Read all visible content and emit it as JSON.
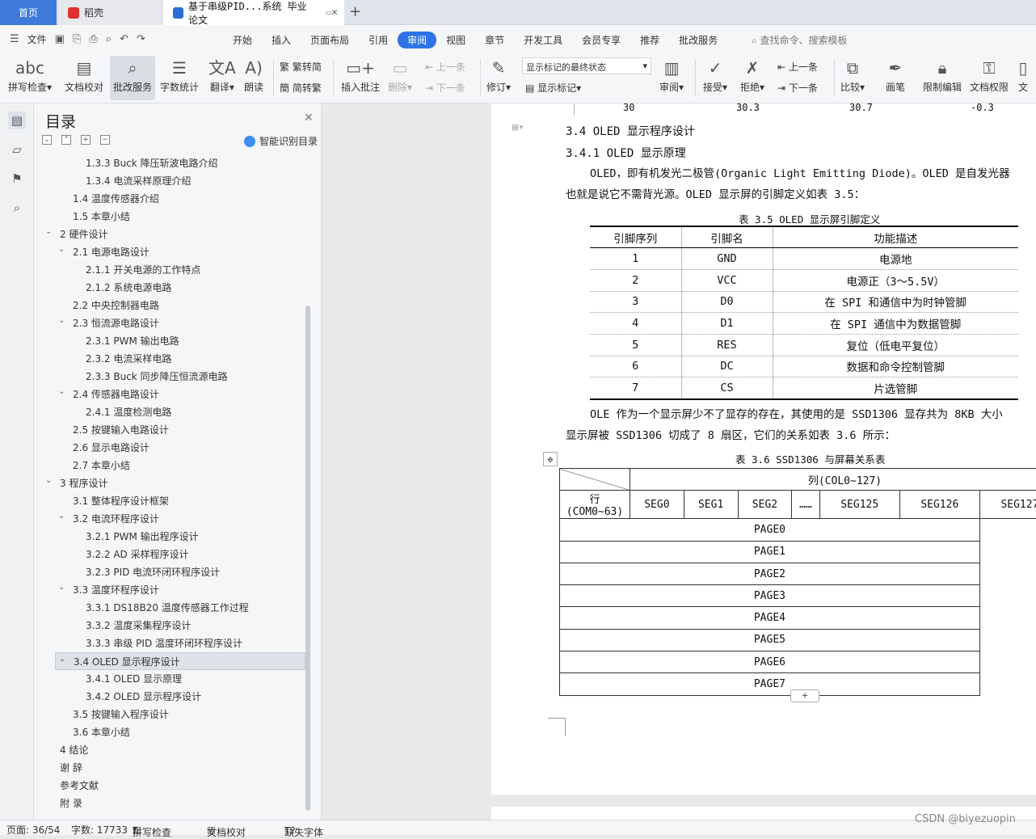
{
  "tabs": {
    "home": "首页",
    "daoke": "稻壳",
    "doc": "基于串级PID...系统 毕业论文"
  },
  "menubar": {
    "file": "文件",
    "items": [
      "开始",
      "插入",
      "页面布局",
      "引用",
      "审阅",
      "视图",
      "章节",
      "开发工具",
      "会员专享",
      "推荐",
      "批改服务"
    ],
    "active": "审阅",
    "search": "查找命令、搜索模板"
  },
  "ribbon": {
    "spell": "拼写检查",
    "doc_proof": "文档校对",
    "review_service": "批改服务",
    "word_count": "字数统计",
    "translate": "翻译",
    "read_aloud": "朗读",
    "to_traditional": "繁转简",
    "to_simplified": "简转繁",
    "insert_comment": "插入批注",
    "delete": "删除",
    "prev": "上一条",
    "next": "下一条",
    "track": "修订",
    "markup_state": "显示标记的最终状态",
    "show_markup": "显示标记",
    "review": "审阅",
    "accept": "接受",
    "reject": "拒绝",
    "prev2": "上一条",
    "next2": "下一条",
    "compare": "比较",
    "pen": "画笔",
    "restrict": "限制编辑",
    "doc_rights": "文档权限",
    "doc_cut": "文"
  },
  "toc": {
    "title": "目录",
    "smart": "智能识别目录",
    "items": [
      {
        "text": "1.3.3 Buck 降压斩波电路介绍",
        "level": 3
      },
      {
        "text": "1.3.4 电流采样原理介绍",
        "level": 3
      },
      {
        "text": "1.4  温度传感器介绍",
        "level": 2
      },
      {
        "text": "1.5  本章小结",
        "level": 2
      },
      {
        "text": "2   硬件设计",
        "level": 1,
        "arrow": true
      },
      {
        "text": "2.1  电源电路设计",
        "level": 2,
        "arrow": true
      },
      {
        "text": "2.1.1 开关电源的工作特点",
        "level": 3
      },
      {
        "text": "2.1.2 系统电源电路",
        "level": 3
      },
      {
        "text": "2.2  中央控制器电路",
        "level": 2
      },
      {
        "text": "2.3  恒流源电路设计",
        "level": 2,
        "arrow": true
      },
      {
        "text": "2.3.1 PWM 输出电路",
        "level": 3
      },
      {
        "text": "2.3.2 电流采样电路",
        "level": 3
      },
      {
        "text": "2.3.3 Buck 同步降压恒流源电路",
        "level": 3
      },
      {
        "text": "2.4  传感器电路设计",
        "level": 2,
        "arrow": true
      },
      {
        "text": "2.4.1 温度检测电路",
        "level": 3
      },
      {
        "text": "2.5  按键输入电路设计",
        "level": 2
      },
      {
        "text": "2.6  显示电路设计",
        "level": 2
      },
      {
        "text": "2.7  本章小结",
        "level": 2
      },
      {
        "text": "3   程序设计",
        "level": 1,
        "arrow": true
      },
      {
        "text": "3.1  整体程序设计框架",
        "level": 2
      },
      {
        "text": "3.2  电流环程序设计",
        "level": 2,
        "arrow": true
      },
      {
        "text": "3.2.1 PWM 输出程序设计",
        "level": 3
      },
      {
        "text": "3.2.2 AD 采样程序设计",
        "level": 3
      },
      {
        "text": "3.2.3 PID 电流环闭环程序设计",
        "level": 3
      },
      {
        "text": "3.3  温度环程序设计",
        "level": 2,
        "arrow": true
      },
      {
        "text": "3.3.1 DS18B20 温度传感器工作过程",
        "level": 3
      },
      {
        "text": "3.3.2 温度采集程序设计",
        "level": 3
      },
      {
        "text": "3.3.3 串级 PID 温度环闭环程序设计",
        "level": 3
      },
      {
        "text": "3.4 OLED 显示程序设计",
        "level": 2,
        "arrow": true,
        "selected": true
      },
      {
        "text": "3.4.1 OLED 显示原理",
        "level": 3
      },
      {
        "text": "3.4.2 OLED 显示程序设计",
        "level": 3
      },
      {
        "text": "3.5  按键输入程序设计",
        "level": 2
      },
      {
        "text": "3.6  本章小结",
        "level": 2
      },
      {
        "text": "4   结论",
        "level": 1
      },
      {
        "text": "谢   辞",
        "level": 1
      },
      {
        "text": "参考文献",
        "level": 1
      },
      {
        "text": "附   录",
        "level": 1
      }
    ]
  },
  "doc": {
    "prev_row": [
      "30",
      "30.3",
      "30.7",
      "-0.3"
    ],
    "h_34": "3.4 OLED 显示程序设计",
    "h_341": "3.4.1 OLED 显示原理",
    "p1_line1": "OLED，即有机发光二极管(Organic Light Emitting Diode)。OLED 是自发光器",
    "p1_line2": "也就是说它不需背光源。OLED 显示屏的引脚定义如表 3.5：",
    "cap35": "表 3.5 OLED 显示屏引脚定义",
    "tbl35_headers": [
      "引脚序列",
      "引脚名",
      "功能描述"
    ],
    "tbl35_rows": [
      [
        "1",
        "GND",
        "电源地"
      ],
      [
        "2",
        "VCC",
        "电源正（3～5.5V）"
      ],
      [
        "3",
        "D0",
        "在 SPI 和通信中为时钟管脚"
      ],
      [
        "4",
        "D1",
        "在 SPI 通信中为数据管脚"
      ],
      [
        "5",
        "RES",
        "复位（低电平复位）"
      ],
      [
        "6",
        "DC",
        "数据和命令控制管脚"
      ],
      [
        "7",
        "CS",
        "片选管脚"
      ]
    ],
    "p2_line1": "OLE 作为一个显示屏少不了显存的存在，其使用的是 SSD1306 显存共为 8KB 大小",
    "p2_line2": "显示屏被 SSD1306 切成了 8 扇区，它们的关系如表 3.6 所示：",
    "cap36": "表 3.6 SSD1306 与屏幕关系表",
    "tbl36_col_header": "列(COL0~127)",
    "tbl36_row_header_1": "行",
    "tbl36_row_header_2": "(COM0~63)",
    "tbl36_segs": [
      "SEG0",
      "SEG1",
      "SEG2",
      "……",
      "SEG125",
      "SEG126",
      "SEG127"
    ],
    "tbl36_pages": [
      "PAGE0",
      "PAGE1",
      "PAGE2",
      "PAGE3",
      "PAGE4",
      "PAGE5",
      "PAGE6",
      "PAGE7"
    ]
  },
  "status": {
    "page": "页面: 36/54",
    "words": "字数: 17733",
    "spell": "拼写检查",
    "proof": "文档校对",
    "missing_font": "缺失字体"
  },
  "watermark": "CSDN @biyezuopin"
}
